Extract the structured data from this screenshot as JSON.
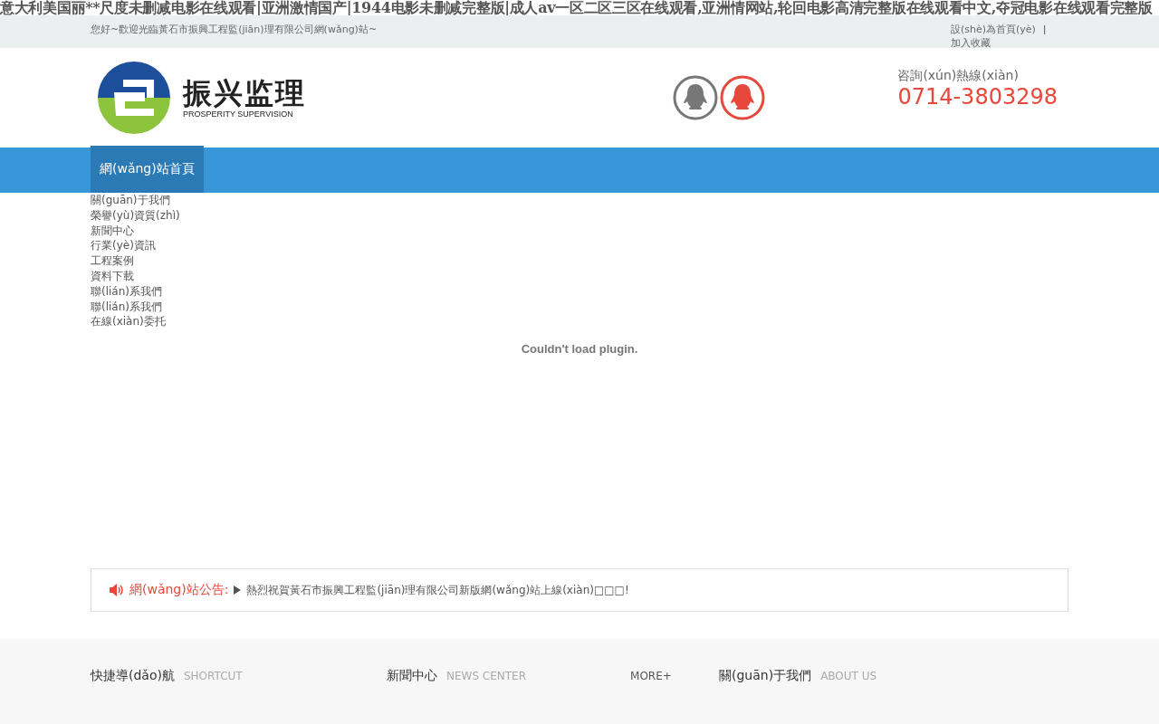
{
  "page_heading": "意大利美国丽**尺度未删减电影在线观看|亚洲激情国产|1944电影未删减完整版|成人av一区二区三区在线观看,亚洲情网站,轮回电影高清完整版在线观看中文,夺冠电影在线观看完整版",
  "top_bar": {
    "welcome": "您好~歡迎光臨黃石市振興工程監(jiān)理有限公司網(wǎng)站~",
    "links": [
      "設(shè)為首頁(yè)",
      "加入收藏"
    ],
    "separator": "ǀ"
  },
  "logo": {
    "name": "振兴监理",
    "tagline": "PROSPERITY SUPERVISION"
  },
  "qq_icons": [
    {
      "color": "#777777"
    },
    {
      "color": "#e8483b"
    }
  ],
  "hotline": {
    "label": "咨詢(xún)熱線(xiàn)",
    "number": "0714-3803298"
  },
  "nav": [
    {
      "label": "網(wǎng)站首頁",
      "selected": true
    }
  ],
  "menu_links": [
    "關(guān)于我們",
    "榮譽(yù)資質(zhì)",
    "新聞中心",
    "行業(yè)資訊",
    "工程案例",
    "資料下載",
    "聯(lián)系我們",
    "聯(lián)系我們",
    "在線(xiàn)委托"
  ],
  "plugin_message": "Couldn't load plugin.",
  "notice": {
    "label": "網(wǎng)站公告:",
    "text": "熱烈祝賀黃石市振興工程監(jiān)理有限公司新版網(wǎng)站上線(xiàn)□□□!"
  },
  "footer": {
    "columns": [
      {
        "title": "快捷導(dǎo)航",
        "subtitle": "SHORTCUT"
      },
      {
        "title": "新聞中心",
        "subtitle": "NEWS CENTER",
        "more": "MORE+"
      },
      {
        "title": "關(guān)于我們",
        "subtitle": "ABOUT US"
      }
    ]
  }
}
